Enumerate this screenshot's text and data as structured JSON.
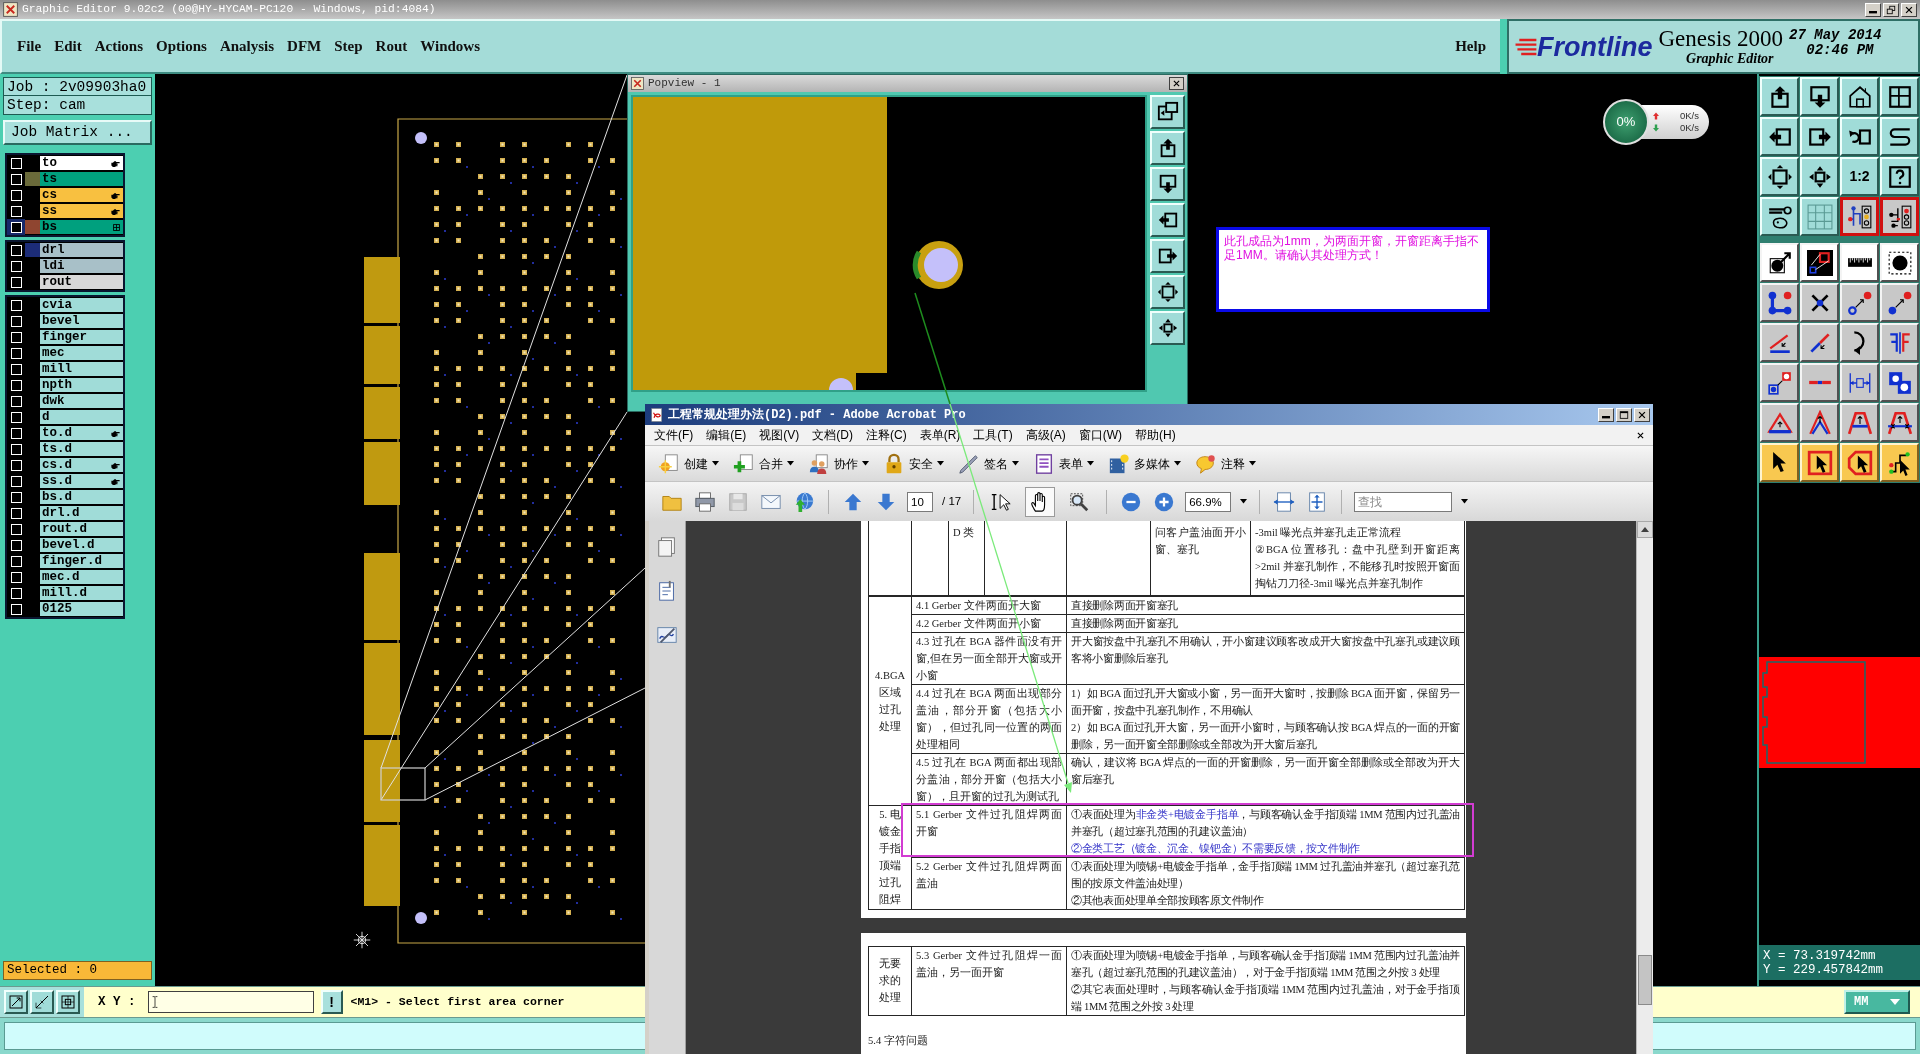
{
  "window": {
    "title": "Graphic Editor 9.02c2 (00@HY-HYCAM-PC120 - Windows, pid:4084)"
  },
  "menu": [
    "File",
    "Edit",
    "Actions",
    "Options",
    "Analysis",
    "DFM",
    "Step",
    "Rout",
    "Windows"
  ],
  "help_menu": "Help",
  "brand": {
    "logo": "Frontline",
    "product": "Genesis 2000",
    "subtitle": "Graphic Editor",
    "date": "27 May 2014",
    "time": "02:46 PM"
  },
  "job_panel": {
    "job": "Job : 2v09903ha0",
    "step": "Step: cam",
    "matrix_button": "Job Matrix ...",
    "selected_count": "Selected : 0"
  },
  "layer_groups": [
    [
      {
        "name": "to",
        "kind": "silkscreen",
        "hand_mark": true,
        "grid_mark": false,
        "selected": false
      },
      {
        "name": "ts",
        "kind": "soldermask",
        "color": "#6a6a3a",
        "hand_mark": false,
        "grid_mark": false,
        "selected": false
      },
      {
        "name": "cs",
        "kind": "signal",
        "hand_mark": true,
        "grid_mark": false,
        "selected": false
      },
      {
        "name": "ss",
        "kind": "signal",
        "hand_mark": true,
        "grid_mark": false,
        "selected": false
      },
      {
        "name": "bs",
        "kind": "soldermask",
        "color": "#8f4530",
        "hand_mark": false,
        "grid_mark": true,
        "selected": true
      }
    ],
    [
      {
        "name": "drl",
        "kind": "drill",
        "color": "#1c2c78",
        "hand_mark": false,
        "grid_mark": false,
        "selected": false
      },
      {
        "name": "ldi",
        "kind": "drill",
        "hand_mark": false,
        "grid_mark": false,
        "selected": false
      },
      {
        "name": "rout",
        "kind": "rout",
        "hand_mark": false,
        "grid_mark": false,
        "selected": false
      }
    ],
    [
      {
        "name": "cvia",
        "kind": "misc",
        "hand_mark": false,
        "grid_mark": false,
        "selected": false
      },
      {
        "name": "bevel",
        "kind": "misc",
        "hand_mark": false,
        "grid_mark": false,
        "selected": false
      },
      {
        "name": "finger",
        "kind": "misc",
        "hand_mark": false,
        "grid_mark": false,
        "selected": false
      },
      {
        "name": "mec",
        "kind": "misc",
        "hand_mark": false,
        "grid_mark": false,
        "selected": false
      },
      {
        "name": "mill",
        "kind": "misc",
        "hand_mark": false,
        "grid_mark": false,
        "selected": false
      },
      {
        "name": "npth",
        "kind": "misc",
        "hand_mark": false,
        "grid_mark": false,
        "selected": false
      },
      {
        "name": "dwk",
        "kind": "misc",
        "hand_mark": false,
        "grid_mark": false,
        "selected": false
      },
      {
        "name": "d",
        "kind": "misc",
        "hand_mark": false,
        "grid_mark": false,
        "selected": false
      },
      {
        "name": "to.d",
        "kind": "misc",
        "hand_mark": true,
        "grid_mark": false,
        "selected": false
      },
      {
        "name": "ts.d",
        "kind": "misc",
        "hand_mark": false,
        "grid_mark": false,
        "selected": false
      },
      {
        "name": "cs.d",
        "kind": "misc",
        "hand_mark": true,
        "grid_mark": false,
        "selected": false
      },
      {
        "name": "ss.d",
        "kind": "misc",
        "hand_mark": true,
        "grid_mark": false,
        "selected": false
      },
      {
        "name": "bs.d",
        "kind": "misc",
        "hand_mark": false,
        "grid_mark": false,
        "selected": false
      },
      {
        "name": "drl.d",
        "kind": "misc",
        "hand_mark": false,
        "grid_mark": false,
        "selected": false
      },
      {
        "name": "rout.d",
        "kind": "misc",
        "hand_mark": false,
        "grid_mark": false,
        "selected": false
      },
      {
        "name": "bevel.d",
        "kind": "misc",
        "hand_mark": false,
        "grid_mark": false,
        "selected": false
      },
      {
        "name": "finger.d",
        "kind": "misc",
        "hand_mark": false,
        "grid_mark": false,
        "selected": false
      },
      {
        "name": "mec.d",
        "kind": "misc",
        "hand_mark": false,
        "grid_mark": false,
        "selected": false
      },
      {
        "name": "mill.d",
        "kind": "misc",
        "hand_mark": false,
        "grid_mark": false,
        "selected": false
      },
      {
        "name": "0125",
        "kind": "misc",
        "hand_mark": false,
        "grid_mark": false,
        "selected": false
      }
    ]
  ],
  "popview": {
    "title": "Popview - 1"
  },
  "message": "此孔成品为1mm，为两面开窗，开窗距离手指不足1MM。请确认其处理方式！",
  "network": {
    "percent": "0%",
    "upload": "0K/s",
    "download": "0K/s"
  },
  "toolbar": {
    "ratio_label": "1:2"
  },
  "coordinates": {
    "x": "X = 73.319742mm",
    "y": "Y = 229.457842mm"
  },
  "command_bar": {
    "xy_label": "X Y :",
    "alert_button": "!",
    "prompt": "<M1> - Select first area corner",
    "units": "MM"
  },
  "acrobat": {
    "title": "工程常规处理办法(D2).pdf - Adobe Acrobat Pro",
    "menu": [
      "文件(F)",
      "编辑(E)",
      "视图(V)",
      "文档(D)",
      "注释(C)",
      "表单(R)",
      "工具(T)",
      "高级(A)",
      "窗口(W)",
      "帮助(H)"
    ],
    "tasks": [
      "创建",
      "合并",
      "协作",
      "安全",
      "签名",
      "表单",
      "多媒体",
      "注释"
    ],
    "page_number": "10",
    "page_count": "/ 17",
    "tools": [
      {
        "selected": false
      },
      {
        "selected": true
      },
      {
        "selected": false
      }
    ],
    "zoom": "66.9%",
    "search_placeholder": "查找",
    "document": {
      "top_row": {
        "column_3": "D 类",
        "column_6": "问客户盖油面开小窗、塞孔",
        "column_7": [
          "-3mil 曝光点并塞孔走正常流程",
          "②BGA 位置移孔：盘中孔壁到开窗距离>2mil 并塞孔制作，不能移孔时按照开窗面掏钻刀刀径-3mil 曝光点并塞孔制作"
        ]
      },
      "groups": [
        {
          "heading": "4.BGA 区域过孔处理",
          "rows": [
            {
              "case": "4.1 Gerber 文件两面开大窗",
              "handling": [
                [
                  {
                    "text": "直接删除两面开窗塞孔",
                    "highlighted": false
                  }
                ]
              ]
            },
            {
              "case": "4.2 Gerber 文件两面开小窗",
              "handling": [
                [
                  {
                    "text": "直接删除两面开窗塞孔",
                    "highlighted": false
                  }
                ]
              ]
            },
            {
              "case": "4.3 过孔在 BGA 器件面没有开窗,但在另一面全部开大窗或开小窗",
              "handling": [
                [
                  {
                    "text": "开大窗按盘中孔塞孔不用确认，开小窗建议顾客改成开大窗按盘中孔塞孔或建议顾客将小窗删除后塞孔",
                    "highlighted": false
                  }
                ]
              ]
            },
            {
              "case": "4.4 过孔在 BGA 两面出现部分盖油，部分开窗（包括大小窗），但过孔同一位置的两面处理相同",
              "handling": [
                [
                  {
                    "text": "1）如 BGA 面过孔开大窗或小窗，另一面开大窗时，按删除 BGA 面开窗，保留另一面开窗，按盘中孔塞孔制作，不用确认",
                    "highlighted": false
                  }
                ],
                [
                  {
                    "text": "2）如 BGA 面过孔开大窗，另一面开小窗时，与顾客确认按 BGA 焊点的一面的开窗删除，另一面开窗全部删除或全部改为开大窗后塞孔",
                    "highlighted": false
                  }
                ]
              ]
            },
            {
              "case": "4.5 过孔在 BGA 两面都出现部分盖油，部分开窗（包括大小窗），且开窗的过孔为测试孔",
              "handling": [
                [
                  {
                    "text": "确认，建议将 BGA 焊点的一面的开窗删除，另一面开窗全部删除或全部改为开大窗后塞孔",
                    "highlighted": false
                  }
                ]
              ]
            }
          ]
        },
        {
          "heading": "5. 电镀金手指顶端过孔阻焊",
          "rows": [
            {
              "case": "5.1 Gerber 文件过孔阻焊两面开窗",
              "handling": [
                [
                  {
                    "text": "①表面处理为",
                    "highlighted": false
                  },
                  {
                    "text": "非金类+电镀金手指单",
                    "highlighted": true
                  },
                  {
                    "text": "，与顾客确认金手指顶端 1MM 范围内过孔盖油并塞孔（超过塞孔范围的孔建议盖油）",
                    "highlighted": false
                  }
                ],
                [
                  {
                    "text": "②金类工艺（镀金、沉金、镍钯金）不需要反馈，按文件制作",
                    "highlighted": true
                  }
                ]
              ]
            },
            {
              "case": "5.2 Gerber 文件过孔阻焊两面盖油",
              "handling": [
                [
                  {
                    "text": "①表面处理为喷锡+电镀金手指单，金手指顶端 1MM 过孔盖油并塞孔（超过塞孔范围的按原文件盖油处理）",
                    "highlighted": false
                  }
                ],
                [
                  {
                    "text": "②其他表面处理单全部按顾客原文件制作",
                    "highlighted": false
                  }
                ]
              ]
            }
          ]
        }
      ],
      "next_page": {
        "groups": [
          {
            "heading": "无要求的处理",
            "rows": [
              {
                "case": "5.3 Gerber 文件过孔阻焊一面盖油，另一面开窗",
                "handling": [
                  [
                    {
                      "text": "①表面处理为喷锡+电镀金手指单，与顾客确认金手指顶端 1MM 范围内过孔盖油并塞孔（超过塞孔范围的孔建议盖油），对于金手指顶端 1MM 范围之外按 3 处理",
                      "highlighted": false
                    }
                  ],
                  [
                    {
                      "text": "②其它表面处理时，与顾客确认金手指顶端 1MM 范围内过孔盖油，对于金手指顶端 1MM 范围之外按 3 处理",
                      "highlighted": false
                    }
                  ]
                ]
              }
            ]
          }
        ],
        "section_title": "5.4 字符问题"
      }
    }
  }
}
